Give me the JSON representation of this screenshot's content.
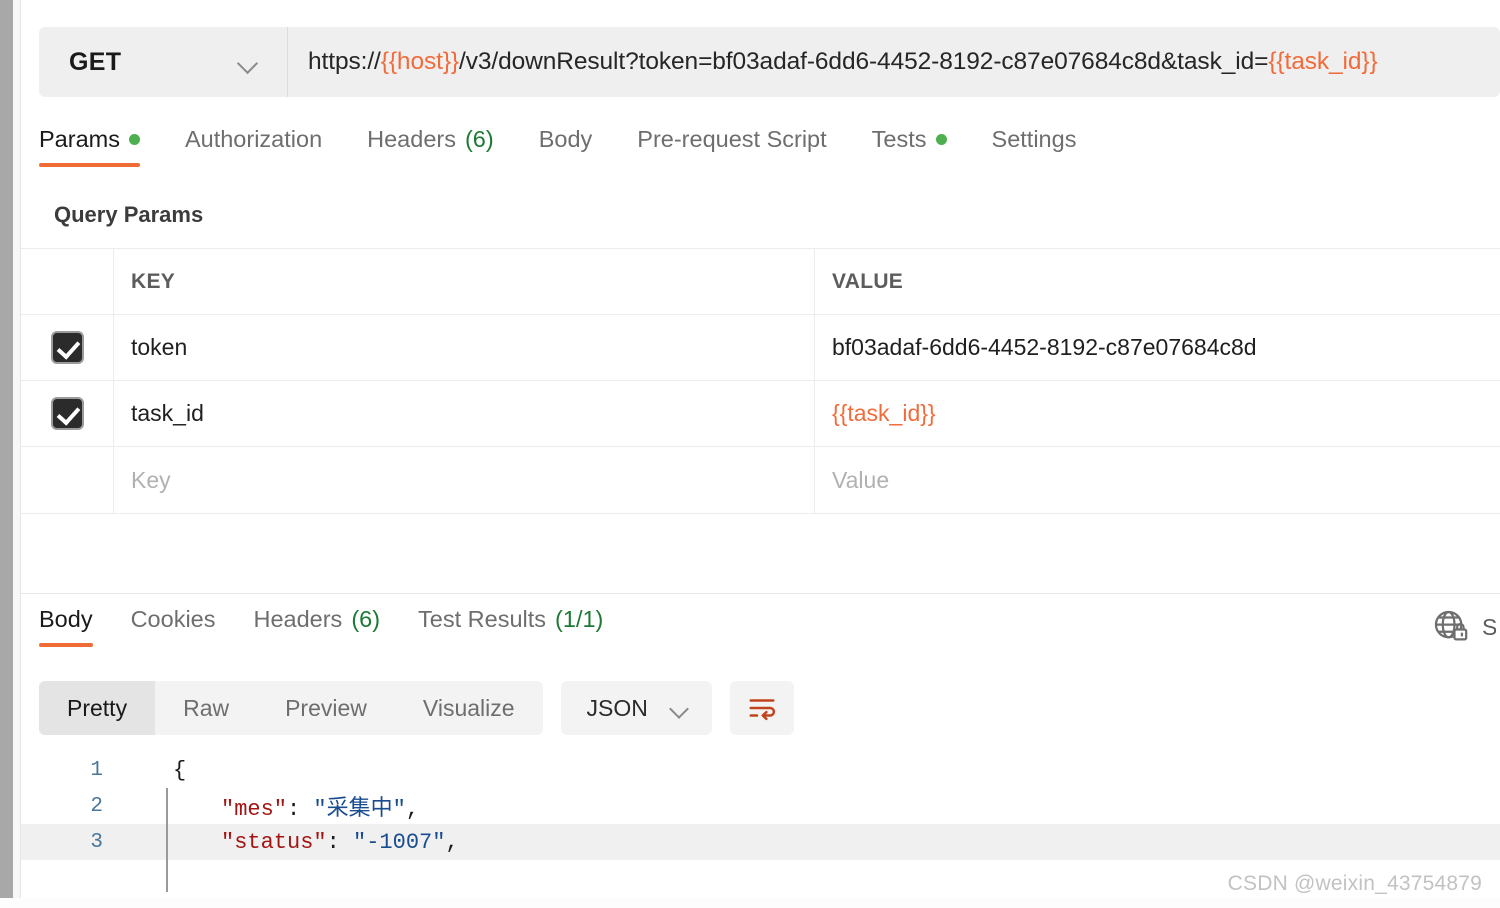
{
  "request": {
    "method": "GET",
    "url_parts": [
      {
        "text": "https://",
        "variable": false
      },
      {
        "text": "{{host}}",
        "variable": true
      },
      {
        "text": "/v3/downResult?token=bf03adaf-6dd6-4452-8192-c87e07684c8d&task_id=",
        "variable": false
      },
      {
        "text": "{{task_id}}",
        "variable": true
      }
    ],
    "url_full": "https://{{host}}/v3/downResult?token=bf03adaf-6dd6-4452-8192-c87e07684c8d&task_id={{task_id}}",
    "tabs": [
      {
        "label": "Params",
        "active": true,
        "dot": true,
        "count": ""
      },
      {
        "label": "Authorization",
        "active": false,
        "dot": false,
        "count": ""
      },
      {
        "label": "Headers",
        "active": false,
        "dot": false,
        "count": "(6)"
      },
      {
        "label": "Body",
        "active": false,
        "dot": false,
        "count": ""
      },
      {
        "label": "Pre-request Script",
        "active": false,
        "dot": false,
        "count": ""
      },
      {
        "label": "Tests",
        "active": false,
        "dot": true,
        "count": ""
      },
      {
        "label": "Settings",
        "active": false,
        "dot": false,
        "count": ""
      }
    ]
  },
  "query_params": {
    "title": "Query Params",
    "columns": {
      "key": "KEY",
      "value": "VALUE"
    },
    "rows": [
      {
        "checked": true,
        "key": "token",
        "value": "bf03adaf-6dd6-4452-8192-c87e07684c8d",
        "value_variable": false
      },
      {
        "checked": true,
        "key": "task_id",
        "value": "{{task_id}}",
        "value_variable": true
      }
    ],
    "empty_row": {
      "key_placeholder": "Key",
      "value_placeholder": "Value"
    }
  },
  "response": {
    "tabs": [
      {
        "label": "Body",
        "active": true,
        "count": ""
      },
      {
        "label": "Cookies",
        "active": false,
        "count": ""
      },
      {
        "label": "Headers",
        "active": false,
        "count": "(6)"
      },
      {
        "label": "Test Results",
        "active": false,
        "count": "(1/1)"
      }
    ],
    "right_icon": "globe-lock-icon",
    "right_text": "S",
    "view_modes": [
      {
        "label": "Pretty",
        "active": true
      },
      {
        "label": "Raw",
        "active": false
      },
      {
        "label": "Preview",
        "active": false
      },
      {
        "label": "Visualize",
        "active": false
      }
    ],
    "format": "JSON",
    "wrap_icon": "word-wrap-icon",
    "body_lines": [
      {
        "number": "1",
        "indent": 0,
        "highlight": false,
        "tokens": [
          {
            "t": "{",
            "c": "pun"
          }
        ]
      },
      {
        "number": "2",
        "indent": 1,
        "highlight": false,
        "tokens": [
          {
            "t": "\"mes\"",
            "c": "key"
          },
          {
            "t": ": ",
            "c": "pun"
          },
          {
            "t": "\"采集中\"",
            "c": "str"
          },
          {
            "t": ",",
            "c": "pun"
          }
        ]
      },
      {
        "number": "3",
        "indent": 1,
        "highlight": true,
        "tokens": [
          {
            "t": "\"status\"",
            "c": "key"
          },
          {
            "t": ": ",
            "c": "pun"
          },
          {
            "t": "\"-1007\"",
            "c": "str"
          },
          {
            "t": ",",
            "c": "pun"
          }
        ]
      }
    ]
  },
  "watermark": "CSDN @weixin_43754879",
  "colors": {
    "accent": "#ef6c37",
    "variable": "#f26b3a",
    "green": "#4caf50",
    "count_green": "#1d7a34",
    "json_key": "#a31515",
    "json_string": "#1a4d8f",
    "line_number": "#4a7799"
  }
}
